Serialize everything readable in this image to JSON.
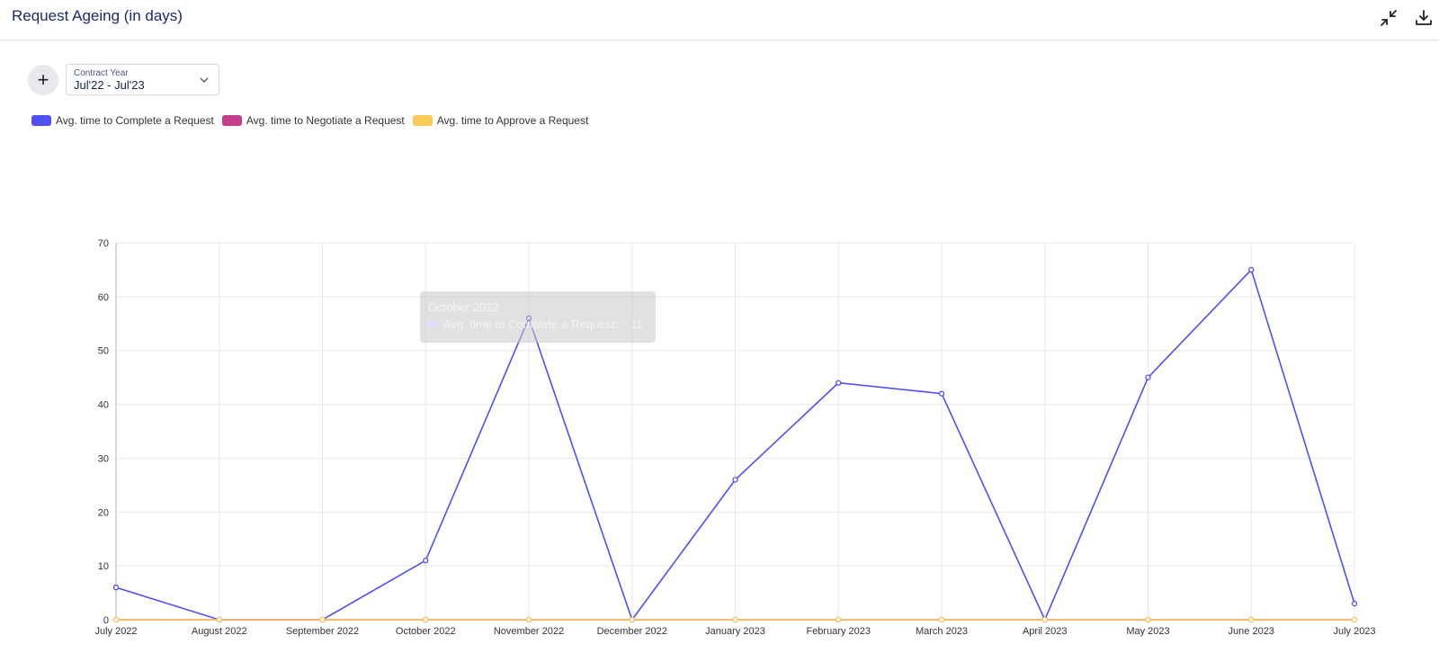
{
  "header": {
    "title": "Request Ageing (in days)",
    "icons": [
      "collapse-icon",
      "download-icon"
    ]
  },
  "filters": {
    "add_label": "+",
    "contract_year_label": "Contract Year",
    "contract_year_value": "Jul'22 - Jul'23"
  },
  "tooltip": {
    "title": "October 2022",
    "series": "Avg. time to Complete a Request:",
    "value": "11"
  },
  "colors": {
    "complete": "#4f4ff5",
    "negotiate": "#c63d8a",
    "approve": "#fdc957",
    "grid": "#e6e8ec"
  },
  "chart_data": {
    "type": "line",
    "categories": [
      "July 2022",
      "August 2022",
      "September 2022",
      "October 2022",
      "November 2022",
      "December 2022",
      "January 2023",
      "February 2023",
      "March 2023",
      "April 2023",
      "May 2023",
      "June 2023",
      "July 2023"
    ],
    "ylim": [
      0,
      70
    ],
    "yticks": [
      0,
      10,
      20,
      30,
      40,
      50,
      60,
      70
    ],
    "legend_position": "top-left",
    "grid": true,
    "series": [
      {
        "name": "Avg. time to Complete a Request",
        "color": "#4f4ff5",
        "values": [
          6,
          0,
          0,
          11,
          56,
          0,
          26,
          44,
          42,
          0,
          45,
          65,
          3
        ]
      },
      {
        "name": "Avg. time to Negotiate a Request",
        "color": "#c63d8a",
        "values": [
          0,
          0,
          0,
          0,
          0,
          0,
          0,
          0,
          0,
          0,
          0,
          0,
          0
        ]
      },
      {
        "name": "Avg. time to Approve a Request",
        "color": "#fdc957",
        "values": [
          0,
          0,
          0,
          0,
          0,
          0,
          0,
          0,
          0,
          0,
          0,
          0,
          0
        ]
      }
    ]
  }
}
